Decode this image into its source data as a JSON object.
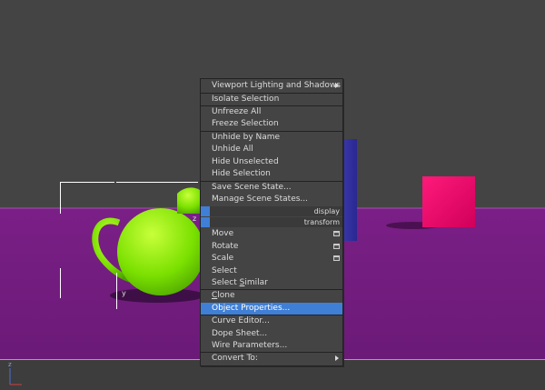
{
  "viewport": {
    "colors": {
      "ground": "#6b1a78",
      "sky": "#444444",
      "highlight": "#3f7fd6"
    },
    "axis_labels": {
      "z": "z",
      "x": "x"
    },
    "gizmo_labels": {
      "z": "z",
      "y": "y"
    }
  },
  "quad_menu": {
    "top_quad": [
      {
        "label": "Viewport Lighting and Shadows",
        "submenu": true
      },
      {
        "label": "Isolate Selection"
      },
      {
        "label": "Unfreeze All"
      },
      {
        "label": "Freeze Selection"
      },
      {
        "label": "Unhide by Name"
      },
      {
        "label": "Unhide All"
      },
      {
        "label": "Hide Unselected"
      },
      {
        "label": "Hide Selection"
      },
      {
        "label": "Save Scene State..."
      },
      {
        "label": "Manage Scene States..."
      }
    ],
    "quad_headers": {
      "display": "display",
      "transform": "transform"
    },
    "bottom_quad": [
      {
        "label": "Move",
        "options_box": true
      },
      {
        "label": "Rotate",
        "options_box": true
      },
      {
        "label": "Scale",
        "options_box": true
      },
      {
        "label": "Select"
      },
      {
        "label": "Select Similar",
        "underline_char": "S"
      },
      {
        "label": "Clone",
        "underline_char": "C"
      },
      {
        "label": "Object Properties...",
        "highlighted": true
      },
      {
        "label": "Curve Editor..."
      },
      {
        "label": "Dope Sheet..."
      },
      {
        "label": "Wire Parameters..."
      },
      {
        "label": "Convert To:",
        "submenu": true
      }
    ]
  }
}
